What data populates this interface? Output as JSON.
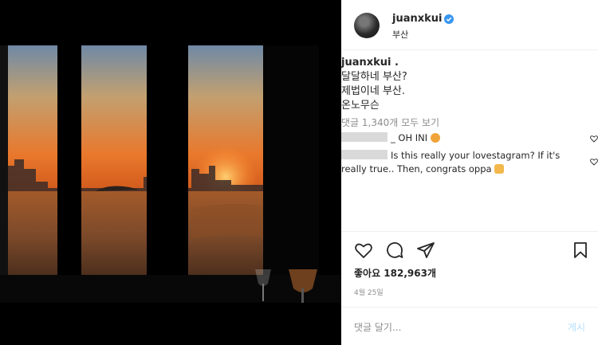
{
  "header": {
    "username": "juanxkui",
    "location": "부산"
  },
  "caption": {
    "username": "juanxkui .",
    "lines": [
      "달달하네 부산?",
      "제법이네 부산.",
      "온노무슨"
    ]
  },
  "view_all_comments": "댓글 1,340개 모두 보기",
  "comments": [
    {
      "text": "_ OH INI",
      "emoji": "angry-face"
    },
    {
      "text": "Is this really your lovestagram? If it's really true.. Then, congrats oppa",
      "emoji": "raising-hands"
    }
  ],
  "likes": "좋아요 182,963개",
  "date": "4월 25일",
  "add_comment": {
    "placeholder": "댓글 달기...",
    "post_label": "게시"
  },
  "colors": {
    "verified": "#3897f0",
    "muted": "#8e8e8e",
    "text": "#262626",
    "post": "#b2dffc"
  }
}
